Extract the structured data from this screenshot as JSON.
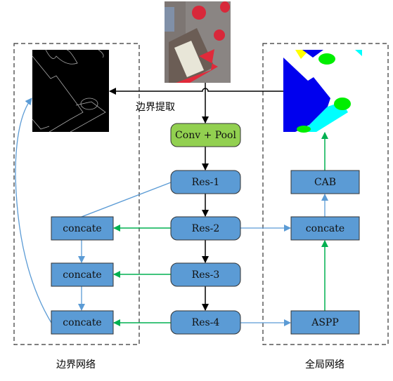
{
  "colors": {
    "node_blue": "#5b9bd5",
    "node_green": "#92d050",
    "arrow_green": "#00b050",
    "arrow_blue": "#5b9bd5",
    "arrow_black": "#000000"
  },
  "labels": {
    "boundary_extraction": "边界提取",
    "boundary_network": "边界网络",
    "global_network": "全局网络"
  },
  "nodes": {
    "conv_pool": "Conv + Pool",
    "res1": "Res-1",
    "res2": "Res-2",
    "res3": "Res-3",
    "res4": "Res-4",
    "left_concat_1": "concate",
    "left_concat_2": "concate",
    "left_concat_3": "concate",
    "right_concat": "concate",
    "cab": "CAB",
    "aspp": "ASPP"
  },
  "images": {
    "input": "aerial-image",
    "boundary": "boundary-map",
    "segmentation": "segmentation-map"
  }
}
